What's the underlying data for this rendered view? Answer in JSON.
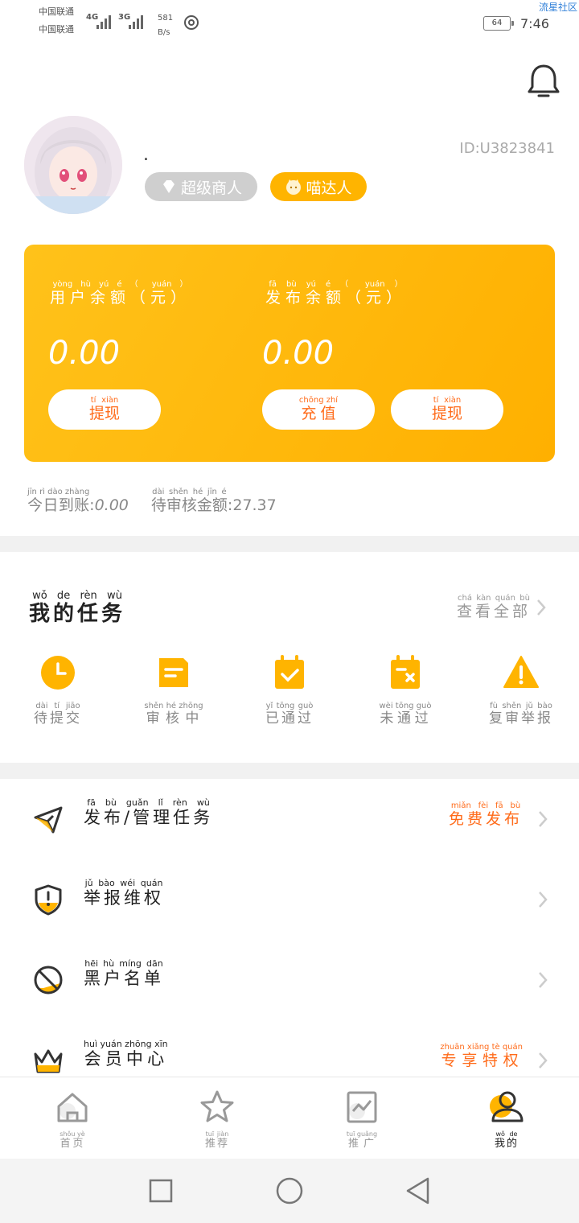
{
  "status_bar": {
    "carrier1": "中国联通",
    "carrier2": "中国联通",
    "net1": "4G",
    "net2": "3G",
    "speed_value": "581",
    "speed_unit": "B/s",
    "battery": "64",
    "time": "7:46",
    "corner_label": "流星社区"
  },
  "profile": {
    "nickname": ".",
    "user_id": "ID:U3823841",
    "badge_vip": "超级商人",
    "badge_miao": "喵达人"
  },
  "balance": {
    "user_balance_label": "用户余额（元）",
    "user_balance": "0.00",
    "publish_balance_label": "发布余额（元）",
    "publish_balance": "0.00",
    "withdraw": "提现",
    "recharge": "充值"
  },
  "stats": {
    "today_label": "今日到账",
    "today_value": "0.00",
    "pending_label": "待审核金额",
    "pending_value": "27.37"
  },
  "tasks": {
    "title": "我的任务",
    "view_all": "查看全部",
    "items": [
      {
        "label": "待提交",
        "icon": "clock-icon"
      },
      {
        "label": "审核中",
        "icon": "document-icon"
      },
      {
        "label": "已通过",
        "icon": "calendar-check-icon"
      },
      {
        "label": "未通过",
        "icon": "calendar-x-icon"
      },
      {
        "label": "复审举报",
        "icon": "warning-icon"
      }
    ]
  },
  "menu": [
    {
      "label": "发布/管理任务",
      "extra": "免费发布",
      "icon": "paper-plane-icon"
    },
    {
      "label": "举报维权",
      "extra": "",
      "icon": "shield-icon"
    },
    {
      "label": "黑户名单",
      "extra": "",
      "icon": "ban-icon"
    },
    {
      "label": "会员中心",
      "extra": "专享特权",
      "icon": "crown-icon"
    }
  ],
  "bottom_nav": [
    {
      "label": "首页",
      "icon": "home-icon"
    },
    {
      "label": "推荐",
      "icon": "star-icon"
    },
    {
      "label": "推广",
      "icon": "chart-icon"
    },
    {
      "label": "我的",
      "icon": "user-icon"
    }
  ],
  "colors": {
    "accent": "#FFB400",
    "highlight": "#FF6B1A"
  }
}
